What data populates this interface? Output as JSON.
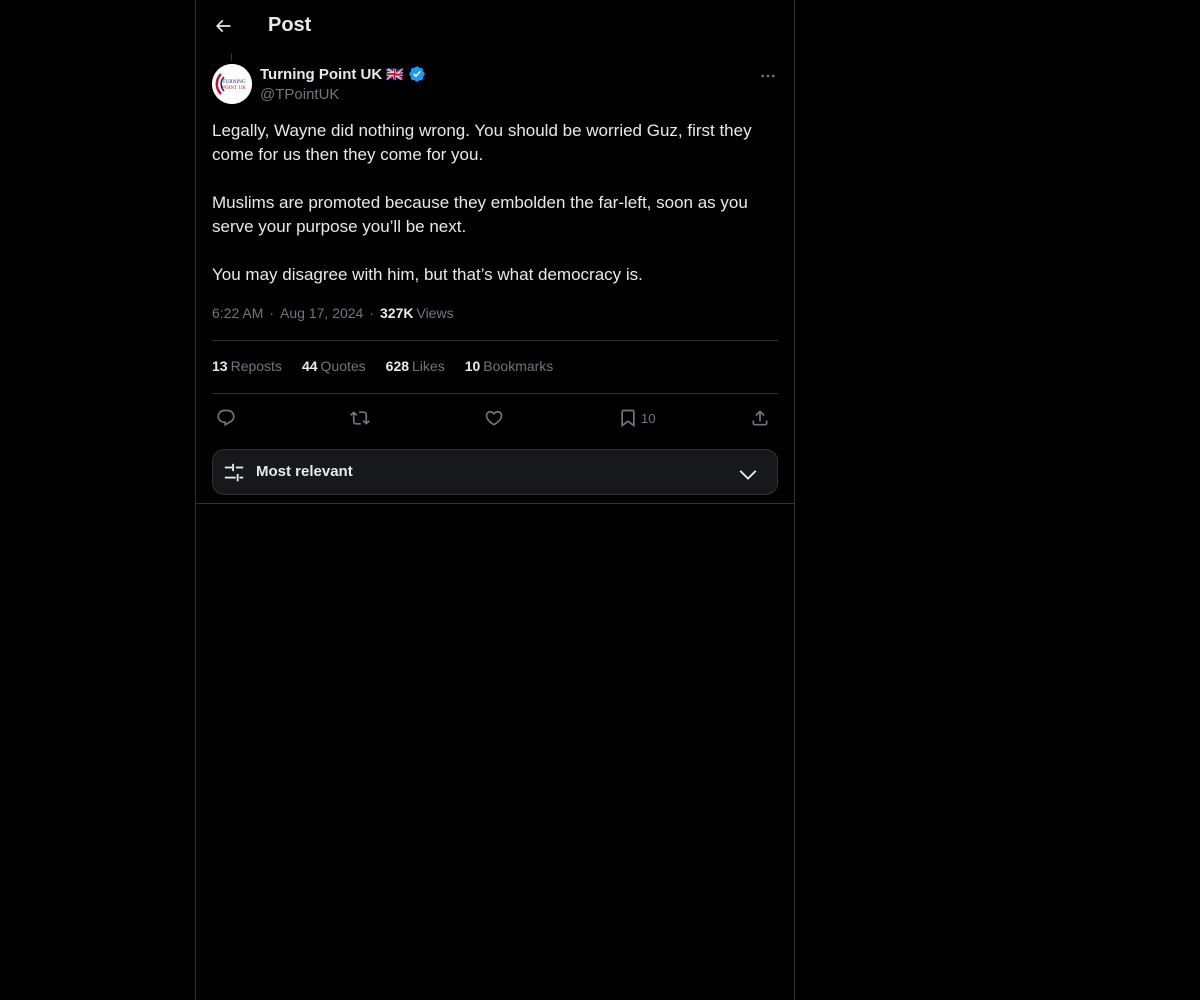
{
  "header": {
    "title": "Post"
  },
  "author": {
    "name": "Turning Point UK",
    "flag": "🇬🇧",
    "handle": "@TPointUK",
    "avatar_text_1": "TURNING",
    "avatar_text_2": "POINT UK"
  },
  "post": {
    "paragraphs": [
      "Legally, Wayne did nothing wrong. You should be worried Guz, first they come for us then they come for you.",
      "Muslims are promoted because they embolden the far-left, soon as you serve your purpose you’ll be next.",
      "You may disagree with him, but that’s what democracy is."
    ],
    "time": "6:22 AM",
    "date": "Aug 17, 2024",
    "views_count": "327K",
    "views_label": "Views"
  },
  "stats": {
    "reposts_count": "13",
    "reposts_label": "Reposts",
    "quotes_count": "44",
    "quotes_label": "Quotes",
    "likes_count": "628",
    "likes_label": "Likes",
    "bookmarks_count": "10",
    "bookmarks_label": "Bookmarks"
  },
  "actions": {
    "bookmark_count": "10"
  },
  "sort": {
    "label": "Most relevant"
  },
  "colors": {
    "background": "#000000",
    "text": "#e7e9ea",
    "muted": "#71767b",
    "border": "#2f3336",
    "verified": "#1d9bf0"
  },
  "icons": [
    "back-arrow-icon",
    "verified-badge-icon",
    "more-dots-icon",
    "reply-icon",
    "repost-icon",
    "like-icon",
    "bookmark-icon",
    "share-icon",
    "sort-sliders-icon",
    "chevron-down-icon"
  ]
}
